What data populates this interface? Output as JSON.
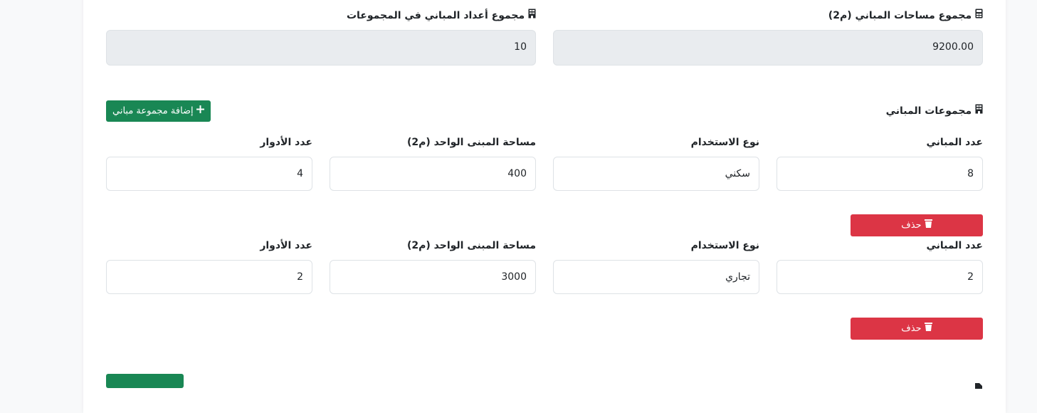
{
  "totals": {
    "area_label": "مجموع مساحات المباني (م2)",
    "area_value": "9200.00",
    "count_label": "مجموع أعداد المباني في المجموعات",
    "count_value": "10"
  },
  "groups_section": {
    "title": "مجموعات المباني",
    "add_button_label": "إضافة مجموعة مباني"
  },
  "field_labels": {
    "count": "عدد المباني",
    "usage": "نوع الاستخدام",
    "unit_area": "مساحة المبنى الواحد (م2)",
    "floors": "عدد الأدوار"
  },
  "groups": [
    {
      "count": "8",
      "usage": "سكني",
      "unit_area": "400",
      "floors": "4",
      "delete_label": "حذف"
    },
    {
      "count": "2",
      "usage": "تجاري",
      "unit_area": "3000",
      "floors": "2",
      "delete_label": "حذف"
    }
  ],
  "icons": {
    "calculator": "calculator-icon",
    "building": "building-icon",
    "plus": "plus-icon",
    "trash": "trash-icon",
    "file": "file-icon"
  },
  "colors": {
    "danger": "#dc3545",
    "success": "#198754",
    "readonly_bg": "#e9ecef"
  }
}
